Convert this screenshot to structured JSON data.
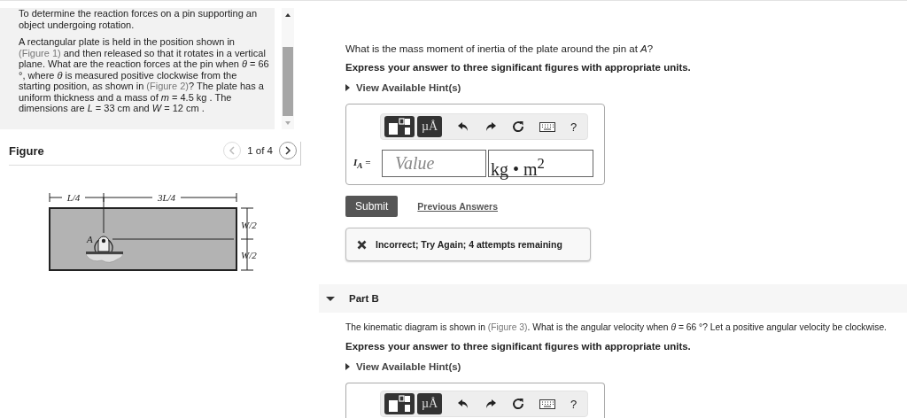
{
  "intro": {
    "paragraphs": [
      [
        {
          "text": "To determine the reaction forces on a pin supporting an object undergoing rotation.",
          "kind": "text"
        }
      ],
      [
        {
          "text": "A rectangular plate is held in the position shown in ",
          "kind": "text"
        },
        {
          "text": "(Figure 1)",
          "kind": "link"
        },
        {
          "text": " and then released so that it rotates in a vertical plane. What are the reaction forces at the pin when *θ* = 66 °, where *θ* is measured positive clockwise from the starting position, as shown in ",
          "kind": "text"
        },
        {
          "text": "(Figure 2)",
          "kind": "link"
        },
        {
          "text": "? The plate has a uniform thickness and a mass of *m* = 4.5 kg . The dimensions are *L* = 33 cm and *W* = 12 cm .",
          "kind": "text"
        }
      ]
    ]
  },
  "figure": {
    "title": "Figure",
    "counter": "1 of 4",
    "prev": {
      "disabled": true
    },
    "next": {
      "disabled": false
    },
    "labels": {
      "left_span": "L/4",
      "right_span": "3L/4",
      "upper_half": "W/2",
      "lower_half": "W/2",
      "pin": "A"
    }
  },
  "part_a": {
    "question": "What is the mass moment of inertia of the plate around the pin at *A*?",
    "instruction": "Express your answer to three significant figures with appropriate units.",
    "hint": {
      "label": "View Available Hint(s)",
      "expanded": false
    },
    "toolbar": {
      "units_button": "µÅ",
      "help_button": "?"
    },
    "answer": {
      "symbol": "*I*$_{A}$ =",
      "placeholder": "Value",
      "unit": "kg • m$^{2}$"
    },
    "submit": "Submit",
    "previous_answers": "Previous Answers",
    "feedback": {
      "kind": "incorrect",
      "text": "Incorrect; Try Again; 4 attempts remaining"
    }
  },
  "part_b": {
    "header": {
      "title": "Part B",
      "expanded": true
    },
    "question": [
      {
        "text": "The kinematic diagram is shown in ",
        "kind": "text"
      },
      {
        "text": "(Figure 3)",
        "kind": "link"
      },
      {
        "text": ". What is the angular velocity when *θ* = 66 °? Let a positive angular velocity be clockwise.",
        "kind": "text"
      }
    ],
    "instruction": "Express your answer to three significant figures with appropriate units.",
    "hint": {
      "label": "View Available Hint(s)",
      "expanded": false
    },
    "toolbar": {
      "units_button": "µÅ",
      "help_button": "?"
    }
  }
}
